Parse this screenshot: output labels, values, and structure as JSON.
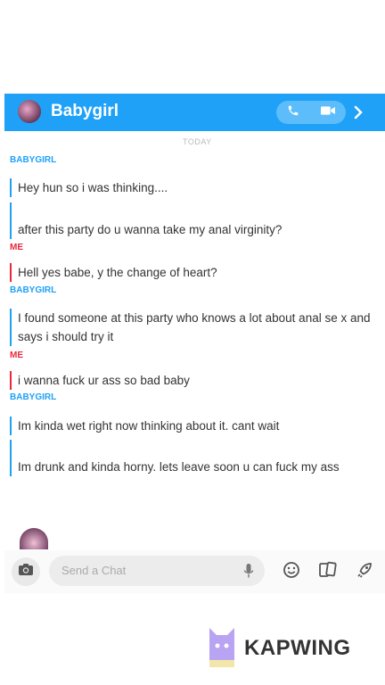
{
  "header": {
    "title": "Babygirl"
  },
  "chat": {
    "date_divider": "TODAY",
    "entries": [
      {
        "sender": "BABYGIRL",
        "role": "them",
        "messages": [
          "Hey hun so i was thinking....",
          "after this party do u wanna take my anal virginity?"
        ]
      },
      {
        "sender": "ME",
        "role": "me",
        "messages": [
          "Hell yes babe, y the change of heart?"
        ]
      },
      {
        "sender": "BABYGIRL",
        "role": "them",
        "messages": [
          "I found someone at this party who knows a lot about anal se x and says i should try it"
        ]
      },
      {
        "sender": "ME",
        "role": "me",
        "messages": [
          "i wanna fuck ur ass so bad baby"
        ]
      },
      {
        "sender": "BABYGIRL",
        "role": "them",
        "messages": [
          "Im kinda wet right now thinking about it. cant wait",
          "Im drunk and kinda horny. lets leave soon u can fuck my ass"
        ]
      }
    ]
  },
  "composer": {
    "placeholder": "Send a Chat"
  },
  "watermark": {
    "text": "KAPWING"
  },
  "colors": {
    "accent": "#1ea1f7",
    "me": "#e8283c"
  }
}
